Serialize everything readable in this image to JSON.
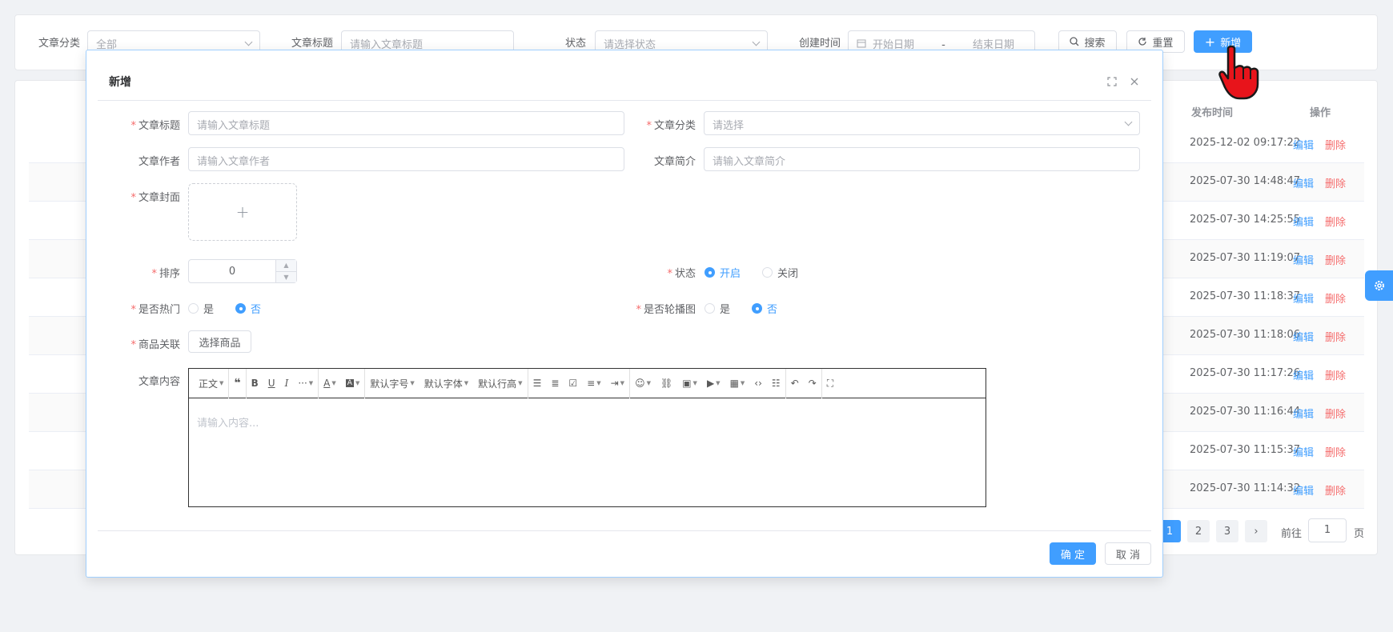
{
  "search": {
    "category_label": "文章分类",
    "category_value": "全部",
    "title_label": "文章标题",
    "title_placeholder": "请输入文章标题",
    "status_label": "状态",
    "status_placeholder": "请选择状态",
    "created_label": "创建时间",
    "start_placeholder": "开始日期",
    "range_sep": "-",
    "end_placeholder": "结束日期",
    "search_btn": "搜索",
    "reset_btn": "重置",
    "add_btn": "新增"
  },
  "table": {
    "col_publish_time": "发布时间",
    "col_actions": "操作",
    "edit_label": "编辑",
    "delete_label": "删除",
    "rows": [
      {
        "publish_time": "2025-12-02 09:17:22"
      },
      {
        "publish_time": "2025-07-30 14:48:47"
      },
      {
        "publish_time": "2025-07-30 14:25:55"
      },
      {
        "publish_time": "2025-07-30 11:19:07"
      },
      {
        "publish_time": "2025-07-30 11:18:37"
      },
      {
        "publish_time": "2025-07-30 11:18:06"
      },
      {
        "publish_time": "2025-07-30 11:17:26"
      },
      {
        "publish_time": "2025-07-30 11:16:44"
      },
      {
        "publish_time": "2025-07-30 11:15:37"
      },
      {
        "publish_time": "2025-07-30 11:14:32"
      }
    ]
  },
  "pagination": {
    "pages": [
      "1",
      "2",
      "3"
    ],
    "current": "1",
    "next": "›",
    "goto_label": "前往",
    "goto_value": "1",
    "page_suffix": "页"
  },
  "dialog": {
    "title": "新增",
    "fields": {
      "title_label": "文章标题",
      "title_placeholder": "请输入文章标题",
      "category_label": "文章分类",
      "category_placeholder": "请选择",
      "author_label": "文章作者",
      "author_placeholder": "请输入文章作者",
      "summary_label": "文章简介",
      "summary_placeholder": "请输入文章简介",
      "cover_label": "文章封面",
      "cover_plus": "+",
      "sort_label": "排序",
      "sort_value": "0",
      "status_label": "状态",
      "status_on": "开启",
      "status_off": "关闭",
      "hot_label": "是否热门",
      "hot_yes": "是",
      "hot_no": "否",
      "carousel_label": "是否轮播图",
      "carousel_yes": "是",
      "carousel_no": "否",
      "product_label": "商品关联",
      "product_btn": "选择商品",
      "content_label": "文章内容",
      "content_placeholder": "请输入内容..."
    },
    "toolbar": {
      "paragraph": "正文",
      "font_size": "默认字号",
      "font_family": "默认字体",
      "line_height": "默认行高",
      "more": "···"
    },
    "ok_btn": "确 定",
    "cancel_btn": "取 消"
  },
  "colors": {
    "primary": "#409eff",
    "danger": "#f56c6c",
    "required": "#f56c6c",
    "cursor": "#e8141b"
  }
}
